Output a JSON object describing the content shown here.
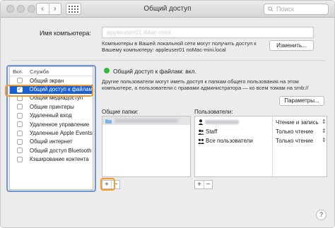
{
  "window": {
    "title": "Общий доступ",
    "search_placeholder": "Поиск"
  },
  "computer": {
    "label": "Имя компьютера:",
    "name_value": "appleuser01 iMac-mini",
    "description": "Компьютеры в Вашей локальной сети могут получить доступ к Вашему компьютеру: appleuser01 noMac-mini.local",
    "change_label": "Изменить..."
  },
  "services": {
    "header_on": "Вкл.",
    "header_service": "Служба",
    "items": [
      {
        "label": "Общий экран",
        "checked": false
      },
      {
        "label": "Общий доступ к файлам",
        "checked": true
      },
      {
        "label": "Общий медиадоступ",
        "checked": false
      },
      {
        "label": "Общие принтеры",
        "checked": false
      },
      {
        "label": "Удаленный вход",
        "checked": false
      },
      {
        "label": "Удаленное управление",
        "checked": false
      },
      {
        "label": "Удаленные Apple Events",
        "checked": false
      },
      {
        "label": "Общий интернет",
        "checked": false
      },
      {
        "label": "Общий доступ Bluetooth",
        "checked": false
      },
      {
        "label": "Кэширование контента",
        "checked": false
      }
    ]
  },
  "status": {
    "text": "Общий доступ к файлам: вкл.",
    "color": "#2cbb3a",
    "description": "Другие пользователи могут иметь доступ к папкам общего пользования на этом компьютере, а пользователи с правами администратора — ко всем томам на smb://",
    "params_label": "Параметры..."
  },
  "folders": {
    "label": "Общие папки:",
    "items": [
      "Public Folder"
    ]
  },
  "users": {
    "label": "Пользователи:",
    "rows": [
      {
        "name": "",
        "permission": "Чтение и запись"
      },
      {
        "name": "Staff",
        "permission": "Только чтение"
      },
      {
        "name": "Все пользователи",
        "permission": "Только чтение"
      }
    ]
  },
  "controls": {
    "plus": "+",
    "minus": "−",
    "help": "?"
  },
  "accent": {
    "highlight": "#f39b2e",
    "selection": "#1a5fd0",
    "frame": "#6e98cc"
  }
}
